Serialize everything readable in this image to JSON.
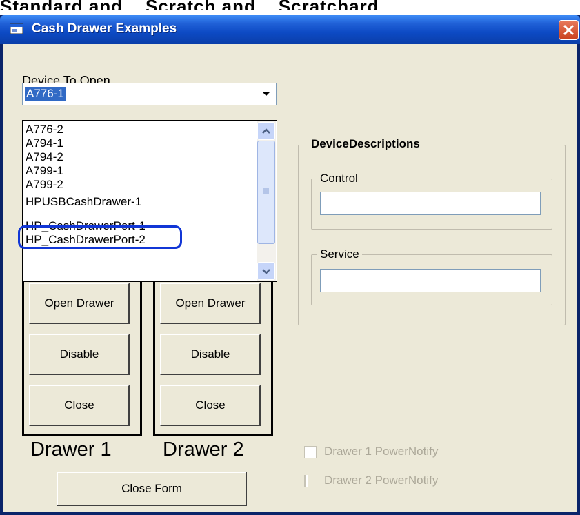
{
  "top_clip_text": "Standard and ...Scratch and ...Scratchard ...",
  "window": {
    "title": "Cash Drawer Examples",
    "colors": {
      "titlebar": "#0a3ea9",
      "client": "#ece9d8",
      "selection": "#316ac5",
      "highlight_ring": "#1136d6"
    }
  },
  "device_to_open": {
    "label": "Device To Open",
    "selected_value": "A776-1",
    "dropdown_items": [
      "A776-2",
      "A794-1",
      "A794-2",
      "A799-1",
      "A799-2",
      "HPUSBCashDrawer-1",
      "HP_CashDrawerPort-1",
      "HP_CashDrawerPort-2"
    ],
    "highlighted_item": "HPUSBCashDrawer-1"
  },
  "drawers": [
    {
      "name": "Drawer 1",
      "open_label": "Open Drawer",
      "disable_label": "Disable",
      "close_label": "Close"
    },
    {
      "name": "Drawer 2",
      "open_label": "Open Drawer",
      "disable_label": "Disable",
      "close_label": "Close"
    }
  ],
  "device_descriptions": {
    "title": "DeviceDescriptions",
    "control_label": "Control",
    "control_value": "",
    "service_label": "Service",
    "service_value": ""
  },
  "power_notify": [
    {
      "label": "Drawer 1 PowerNotify",
      "checked": false,
      "enabled": false
    },
    {
      "label": "Drawer 2 PowerNotify",
      "checked": false,
      "enabled": false
    }
  ],
  "close_form_label": "Close Form",
  "icons": [
    "app-icon",
    "close-icon",
    "dropdown-arrow-icon",
    "scroll-up-icon",
    "scroll-down-icon",
    "scroll-grip-icon"
  ]
}
